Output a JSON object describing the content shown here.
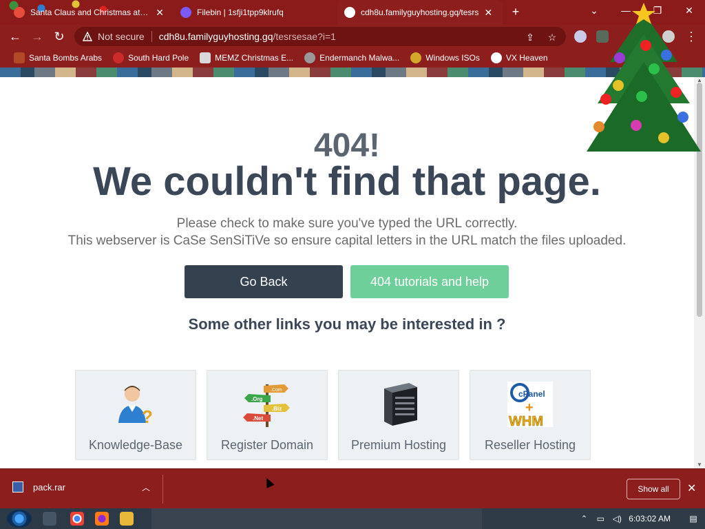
{
  "browser": {
    "tabs": [
      {
        "title": "Santa Claus and Christmas at the",
        "active": false,
        "favicon_color": "#e74c3c"
      },
      {
        "title": "Filebin | 1sfji1tpp9klrufq",
        "active": false,
        "favicon_color": "#7a5af8"
      },
      {
        "title": "cdh8u.familyguyhosting.gq/tesrs",
        "active": true,
        "favicon_color": "#ffffff"
      }
    ],
    "omnibox": {
      "security": "Not secure",
      "host": "cdh8u.familyguyhosting.gq",
      "path": "/tesrsesae?i=1"
    },
    "bookmarks": [
      {
        "label": "Santa Bombs Arabs",
        "icon": "santa-icon",
        "color": "#b24a2a"
      },
      {
        "label": "South Hard Pole",
        "icon": "snowflake-icon",
        "color": "#cc2b2b"
      },
      {
        "label": "MEMZ Christmas E...",
        "icon": "window-icon",
        "color": "#d9d9d9"
      },
      {
        "label": "Endermanch Malwa...",
        "icon": "eye-icon",
        "color": "#999999"
      },
      {
        "label": "Windows ISOs",
        "icon": "coin-icon",
        "color": "#d3a72a"
      },
      {
        "label": "VX Heaven",
        "icon": "heaven-icon",
        "color": "#ffffff"
      }
    ]
  },
  "page": {
    "code": "404!",
    "headline": "We couldn't find that page.",
    "line1": "Please check to make sure you've typed the URL correctly.",
    "line2": "This webserver is CaSe SenSiTiVe so ensure capital letters in the URL match the files uploaded.",
    "buttons": {
      "back": "Go Back",
      "help": "404 tutorials and help"
    },
    "others_heading": "Some other links you may be interested in ?",
    "cards": [
      {
        "label": "Knowledge-Base",
        "icon": "user-question-icon"
      },
      {
        "label": "Register Domain",
        "icon": "domain-signpost-icon",
        "signs": [
          ".Com",
          ".Org",
          ".Biz",
          ".Net"
        ]
      },
      {
        "label": "Premium Hosting",
        "icon": "server-icon"
      },
      {
        "label": "Reseller Hosting",
        "icon": "cpanel-whm-icon",
        "logo_text": [
          "cPanel",
          "+",
          "WHM"
        ]
      }
    ]
  },
  "downloads": {
    "file": "pack.rar",
    "show_all": "Show all"
  },
  "taskbar": {
    "time": "6:03:02 AM"
  }
}
